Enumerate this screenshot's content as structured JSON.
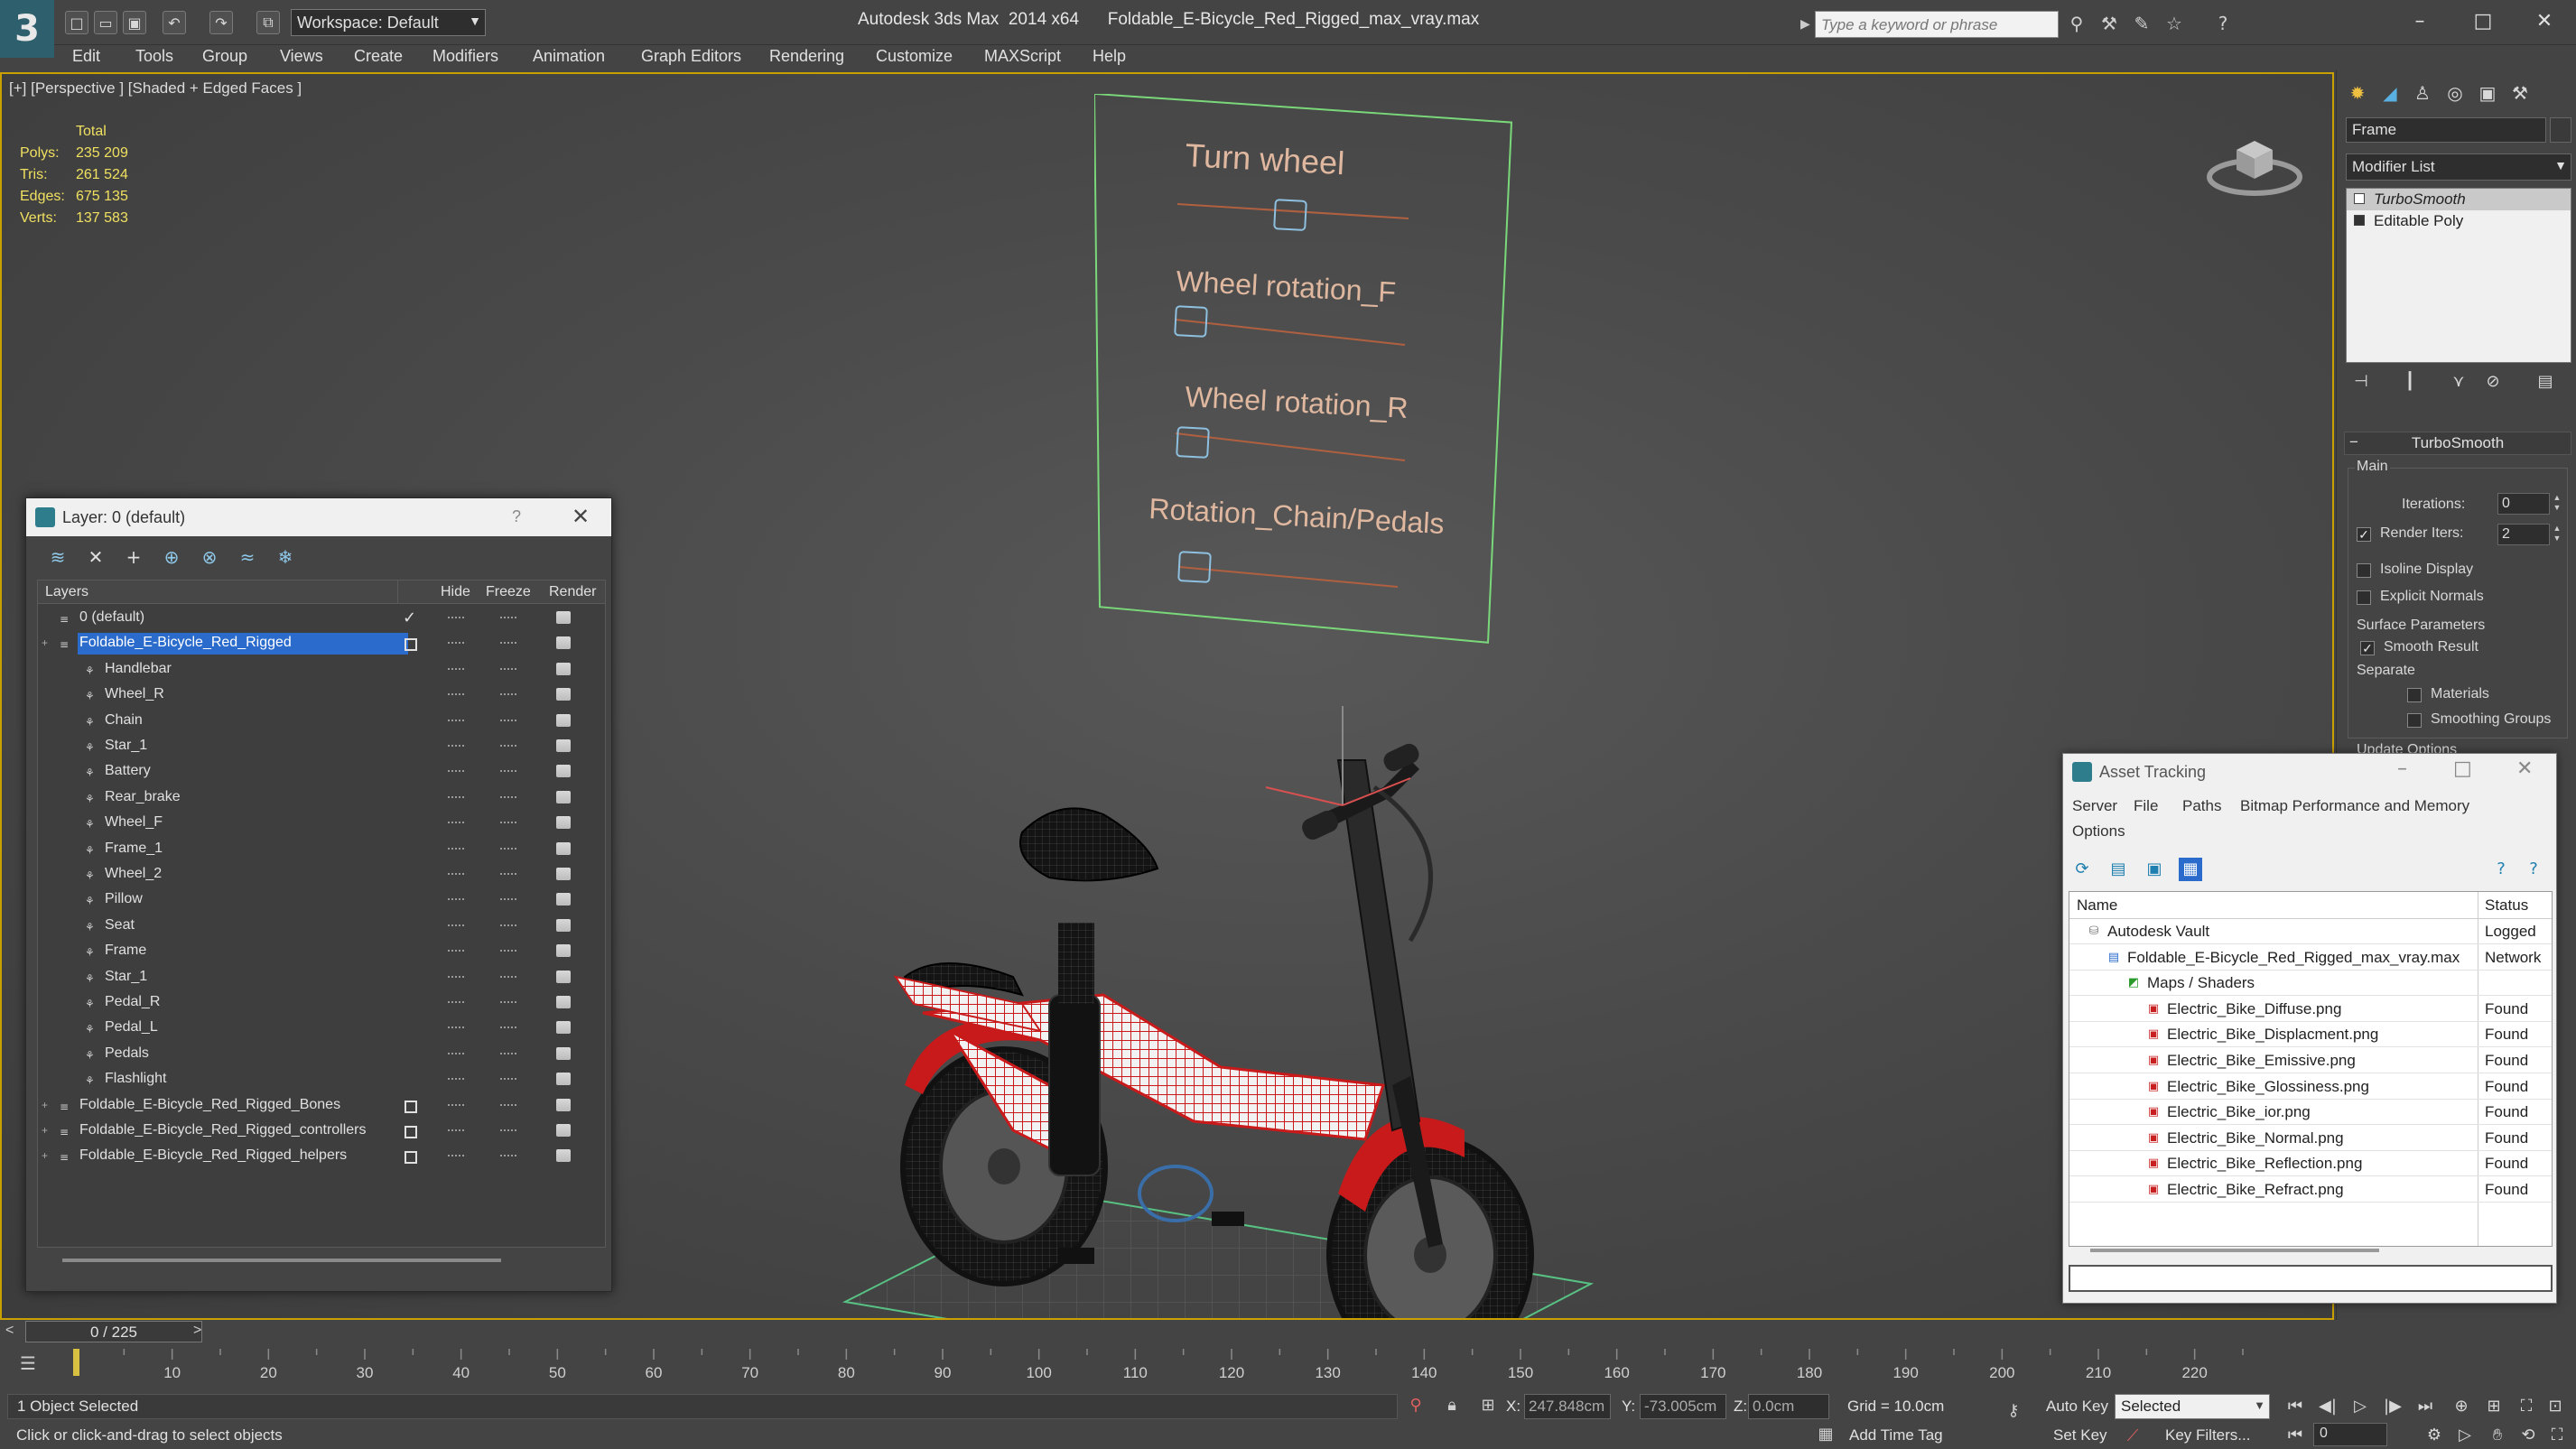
{
  "app": {
    "title_app": "Autodesk 3ds Max  2014 x64",
    "title_file": "Foldable_E-Bicycle_Red_Rigged_max_vray.max",
    "workspace": "Workspace: Default",
    "search_placeholder": "Type a keyword or phrase"
  },
  "menu": [
    "Edit",
    "Tools",
    "Group",
    "Views",
    "Create",
    "Modifiers",
    "Animation",
    "Graph Editors",
    "Rendering",
    "Customize",
    "MAXScript",
    "Help"
  ],
  "viewport": {
    "label": "[+] [Perspective ] [Shaded + Edged Faces ]",
    "stats": {
      "header": "Total",
      "rows": [
        {
          "label": "Polys:",
          "value": "235 209"
        },
        {
          "label": "Tris:",
          "value": "261 524"
        },
        {
          "label": "Edges:",
          "value": "675 135"
        },
        {
          "label": "Verts:",
          "value": "137 583"
        }
      ]
    },
    "rig_controls": [
      "Turn wheel",
      "Wheel rotation_F",
      "Wheel rotation_R",
      "Rotation_Chain/Pedals"
    ]
  },
  "command_panel": {
    "object_name": "Frame",
    "modifier_list": "Modifier List",
    "stack": [
      "TurboSmooth",
      "Editable Poly"
    ],
    "turbosmooth": {
      "title": "TurboSmooth",
      "main_label": "Main",
      "iterations_label": "Iterations:",
      "iterations_value": "0",
      "render_iters_label": "Render Iters:",
      "render_iters_value": "2",
      "render_iters_checked": true,
      "isoline_label": "Isoline Display",
      "explicit_label": "Explicit Normals",
      "surface_label": "Surface Parameters",
      "smooth_label": "Smooth Result",
      "smooth_checked": true,
      "separate_label": "Separate",
      "materials_label": "Materials",
      "smoothing_groups_label": "Smoothing Groups",
      "update_label": "Update Options"
    }
  },
  "layer_window": {
    "title": "Layer: 0 (default)",
    "help": "?",
    "columns": {
      "layers": "Layers",
      "hide": "Hide",
      "freeze": "Freeze",
      "render": "Render"
    },
    "rows": [
      {
        "name": "0 (default)",
        "level": 0,
        "type": "layer",
        "current": true
      },
      {
        "name": "Foldable_E-Bicycle_Red_Rigged",
        "level": 0,
        "type": "layer",
        "selected": true,
        "expandable": true
      },
      {
        "name": "Handlebar",
        "level": 1,
        "type": "object"
      },
      {
        "name": "Wheel_R",
        "level": 1,
        "type": "object"
      },
      {
        "name": "Chain",
        "level": 1,
        "type": "object"
      },
      {
        "name": "Star_1",
        "level": 1,
        "type": "object"
      },
      {
        "name": "Battery",
        "level": 1,
        "type": "object"
      },
      {
        "name": "Rear_brake",
        "level": 1,
        "type": "object"
      },
      {
        "name": "Wheel_F",
        "level": 1,
        "type": "object"
      },
      {
        "name": "Frame_1",
        "level": 1,
        "type": "object"
      },
      {
        "name": "Wheel_2",
        "level": 1,
        "type": "object"
      },
      {
        "name": "Pillow",
        "level": 1,
        "type": "object"
      },
      {
        "name": "Seat",
        "level": 1,
        "type": "object"
      },
      {
        "name": "Frame",
        "level": 1,
        "type": "object"
      },
      {
        "name": "Star_1",
        "level": 1,
        "type": "object"
      },
      {
        "name": "Pedal_R",
        "level": 1,
        "type": "object"
      },
      {
        "name": "Pedal_L",
        "level": 1,
        "type": "object"
      },
      {
        "name": "Pedals",
        "level": 1,
        "type": "object"
      },
      {
        "name": "Flashlight",
        "level": 1,
        "type": "object"
      },
      {
        "name": "Foldable_E-Bicycle_Red_Rigged_Bones",
        "level": 0,
        "type": "layer",
        "expandable": true
      },
      {
        "name": "Foldable_E-Bicycle_Red_Rigged_controllers",
        "level": 0,
        "type": "layer",
        "expandable": true
      },
      {
        "name": "Foldable_E-Bicycle_Red_Rigged_helpers",
        "level": 0,
        "type": "layer",
        "expandable": true
      }
    ]
  },
  "asset_tracking": {
    "title": "Asset Tracking",
    "menu": [
      "Server",
      "File",
      "Paths",
      "Bitmap Performance and Memory",
      "Options"
    ],
    "columns": {
      "name": "Name",
      "status": "Status"
    },
    "rows": [
      {
        "name": "Autodesk Vault",
        "level": 0,
        "icon": "vault",
        "status": "Logged"
      },
      {
        "name": "Foldable_E-Bicycle_Red_Rigged_max_vray.max",
        "level": 1,
        "icon": "file",
        "status": "Network"
      },
      {
        "name": "Maps / Shaders",
        "level": 2,
        "icon": "maps",
        "status": ""
      },
      {
        "name": "Electric_Bike_Diffuse.png",
        "level": 3,
        "icon": "png",
        "status": "Found"
      },
      {
        "name": "Electric_Bike_Displacment.png",
        "level": 3,
        "icon": "png",
        "status": "Found"
      },
      {
        "name": "Electric_Bike_Emissive.png",
        "level": 3,
        "icon": "png",
        "status": "Found"
      },
      {
        "name": "Electric_Bike_Glossiness.png",
        "level": 3,
        "icon": "png",
        "status": "Found"
      },
      {
        "name": "Electric_Bike_ior.png",
        "level": 3,
        "icon": "png",
        "status": "Found"
      },
      {
        "name": "Electric_Bike_Normal.png",
        "level": 3,
        "icon": "png",
        "status": "Found"
      },
      {
        "name": "Electric_Bike_Reflection.png",
        "level": 3,
        "icon": "png",
        "status": "Found"
      },
      {
        "name": "Electric_Bike_Refract.png",
        "level": 3,
        "icon": "png",
        "status": "Found"
      }
    ]
  },
  "timeline": {
    "slider_label": "0 / 225",
    "current_frame": 0,
    "total_frames": 225,
    "ticks": [
      "10",
      "20",
      "30",
      "40",
      "50",
      "60",
      "70",
      "80",
      "90",
      "100",
      "110",
      "120",
      "130",
      "140",
      "150",
      "160",
      "170",
      "180",
      "190",
      "200",
      "210",
      "220"
    ]
  },
  "status": {
    "selected": "1 Object Selected",
    "prompt": "Click or click-and-drag to select objects",
    "x_label": "X:",
    "x_value": "247.848cm",
    "y_label": "Y:",
    "y_value": "-73.005cm",
    "z_label": "Z:",
    "z_value": "0.0cm",
    "grid": "Grid = 10.0cm",
    "add_time_tag": "Add Time Tag",
    "auto_key": "Auto Key",
    "set_key": "Set Key",
    "selection_set": "Selected",
    "key_filters": "Key Filters...",
    "frame_value": "0"
  },
  "colors": {
    "viewport_border": "#c8a000",
    "stats": "#f0e060",
    "selection": "#2a6bcc",
    "rig_panel": "#7ad87a",
    "rig_text": "#e0b8a0",
    "bike_red": "#c81a1a"
  }
}
